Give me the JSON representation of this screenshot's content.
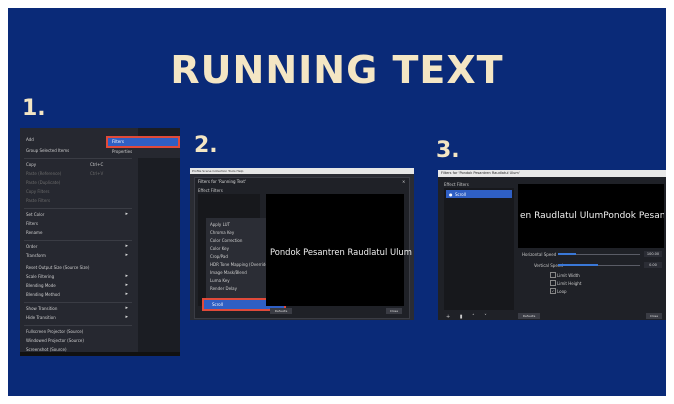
{
  "title": "RUNNING TEXT",
  "steps": [
    "1.",
    "2.",
    "3."
  ],
  "panel1": {
    "menu": [
      "Add",
      "Group Selected Items",
      "Copy",
      "Paste (Reference)",
      "Paste (Duplicate)",
      "Copy Filters",
      "Paste Filters",
      "Set Color",
      "Filters",
      "Rename",
      "Order",
      "Transform",
      "Reset Output Size (Source Size)",
      "Scale Filtering",
      "Blending Mode",
      "Blending Method",
      "Show Transition",
      "Hide Transition",
      "Fullscreen Projector (Source)",
      "Windowed Projector (Source)",
      "Screenshot (Source)"
    ],
    "shortcuts": {
      "copy": "Ctrl+C",
      "paste": "Ctrl+V"
    },
    "submenu": [
      "Filters",
      "Properties"
    ]
  },
  "panel2": {
    "window_title": "Filters for 'Running Text'",
    "menubar": "Profile  Scene Collection  Tools  Help",
    "effect_filters_label": "Effect Filters",
    "filter_list": [
      "Apply LUT",
      "Chroma Key",
      "Color Correction",
      "Color Key",
      "Crop/Pad",
      "HDR Tone Mapping (Override)",
      "Image Mask/Blend",
      "Luma Key",
      "Render Delay"
    ],
    "selected_filter": "Scroll",
    "preview_text": "Pondok Pesantren Raudlatul Ulum",
    "defaults_button": "Defaults",
    "close_button": "Close"
  },
  "panel3": {
    "window_title": "Filters for 'Pondok Pesantren Raudlatul Ulum'",
    "effect_filters_label": "Effect Filters",
    "filter_item": "Scroll",
    "preview_text": "en Raudlatul UlumPondok Pesantr",
    "horizontal_speed_label": "Horizontal Speed",
    "horizontal_speed_value": "100.00",
    "vertical_speed_label": "Vertical Speed",
    "vertical_speed_value": "0.00",
    "checkbox_limit_width": "Limit Width",
    "checkbox_limit_height": "Limit Height",
    "checkbox_loop": "Loop",
    "defaults_button": "Defaults",
    "close_button": "Close"
  }
}
